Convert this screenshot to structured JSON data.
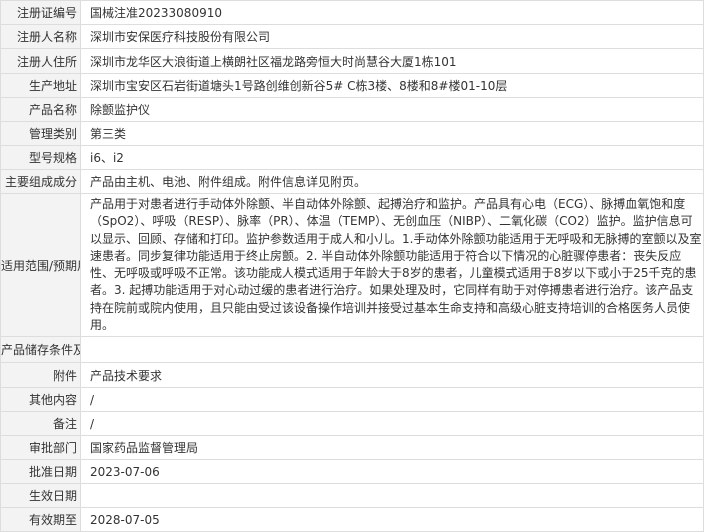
{
  "rows": [
    {
      "label": "注册证编号",
      "value": "国械注准20233080910"
    },
    {
      "label": "注册人名称",
      "value": "深圳市安保医疗科技股份有限公司"
    },
    {
      "label": "注册人住所",
      "value": "深圳市龙华区大浪街道上横朗社区福龙路旁恒大时尚慧谷大厦1栋101"
    },
    {
      "label": "生产地址",
      "value": "深圳市宝安区石岩街道塘头1号路创维创新谷5# C栋3楼、8楼和8#楼01-10层"
    },
    {
      "label": "产品名称",
      "value": "除颤监护仪"
    },
    {
      "label": "管理类别",
      "value": "第三类"
    },
    {
      "label": "型号规格",
      "value": "i6、i2"
    },
    {
      "label": "主要组成成分",
      "value": "产品由主机、电池、附件组成。附件信息详见附页。"
    },
    {
      "label": "适用范围/预期用途",
      "value": "产品用于对患者进行手动体外除颤、半自动体外除颤、起搏治疗和监护。产品具有心电（ECG）、脉搏血氧饱和度（SpO2）、呼吸（RESP）、脉率（PR）、体温（TEMP）、无创血压（NIBP）、二氧化碳（CO2）监护。监护信息可以显示、回顾、存储和打印。监护参数适用于成人和小儿。1.手动体外除颤功能适用于无呼吸和无脉搏的室颤以及室速患者。同步复律功能适用于终止房颤。2. 半自动体外除颤功能适用于符合以下情况的心脏骤停患者：丧失反应性、无呼吸或呼吸不正常。该功能成人模式适用于年龄大于8岁的患者，儿童模式适用于8岁以下或小于25千克的患者。3. 起搏功能适用于对心动过缓的患者进行治疗。如果处理及时，它同样有助于对停搏患者进行治疗。该产品支持在院前或院内使用，且只能由受过该设备操作培训并接受过基本生命支持和高级心脏支持培训的合格医务人员使用。"
    },
    {
      "label": "产品储存条件及有效期",
      "value": ""
    },
    {
      "label": "附件",
      "value": "产品技术要求"
    },
    {
      "label": "其他内容",
      "value": "/"
    },
    {
      "label": "备注",
      "value": "/"
    },
    {
      "label": "审批部门",
      "value": "国家药品监督管理局"
    },
    {
      "label": "批准日期",
      "value": "2023-07-06"
    },
    {
      "label": "生效日期",
      "value": ""
    },
    {
      "label": "有效期至",
      "value": "2028-07-05"
    }
  ]
}
